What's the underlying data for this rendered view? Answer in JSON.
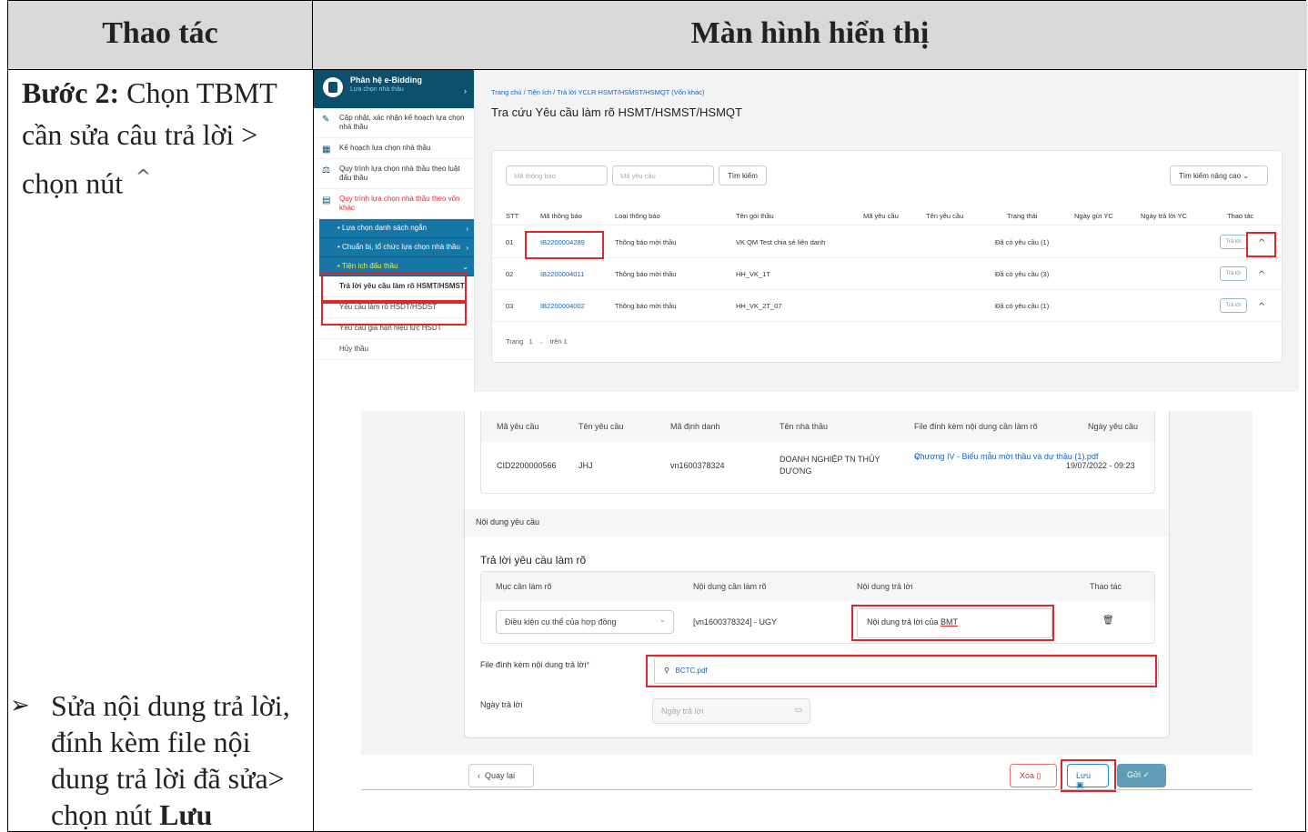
{
  "header": {
    "left": "Thao tác",
    "right": "Màn hình hiển thị"
  },
  "step1": {
    "label": "Bước 2:",
    "text": "Chọn TBMT cần sửa câu trả lời > chọn nút",
    "caret_icon": "chevron-up-icon"
  },
  "step2": {
    "text_a": "Sửa nội dung trả lời, đính kèm file nội dung trả lời đã sửa> chọn nút ",
    "text_b": "Lưu"
  },
  "shot1": {
    "sidebar": {
      "app": "Phân hệ e-Bidding",
      "sub": "Lựa chọn nhà thầu",
      "items": [
        "Cập nhật, xác nhận kế hoạch lựa chọn nhà thầu",
        "Kế hoạch lựa chọn nhà thầu",
        "Quy trình lựa chọn nhà thầu theo luật đấu thầu",
        "Quy trình lựa chọn nhà thầu theo vốn khác"
      ],
      "subs": [
        "Lựa chọn danh sách ngắn",
        "Chuẩn bị, tổ chức lựa chọn nhà thầu",
        "Tiện ích đấu thầu"
      ],
      "leaves": [
        "Trả lời yêu cầu làm rõ HSMT/HSMST",
        "Yêu cầu làm rõ HSDT/HSDST",
        "Yêu cầu gia hạn hiệu lực HSDT",
        "Hủy thầu"
      ]
    },
    "breadcrumb": {
      "home": "Trang chủ",
      "sep": "/",
      "mid": "Tiện ích",
      "last": "Trả lời YCLR HSMT/HSMST/HSMQT (Vốn khác)"
    },
    "title": "Tra cứu Yêu cầu làm rõ HSMT/HSMST/HSMQT",
    "search": {
      "ph1": "Mã thông báo",
      "ph2": "Mã yêu cầu",
      "btn": "Tìm kiếm",
      "adv": "Tìm kiếm nâng cao"
    },
    "columns": [
      "STT",
      "Mã thông báo",
      "Loại thông báo",
      "Tên gói thầu",
      "Mã yêu cầu",
      "Tên yêu cầu",
      "Trạng thái",
      "Ngày gửi YC",
      "Ngày trả lời YC",
      "Thao tác"
    ],
    "rows": [
      {
        "stt": "01",
        "ma": "IB2200004289",
        "loai": "Thông báo mời thầu",
        "ten": "VK QM Test chia sẻ liên danh",
        "tt": "Đã có yêu cầu (1)"
      },
      {
        "stt": "02",
        "ma": "IB2200004011",
        "loai": "Thông báo mời thầu",
        "ten": "HH_VK_1T",
        "tt": "Đã có yêu cầu (3)"
      },
      {
        "stt": "03",
        "ma": "IB2200004002",
        "loai": "Thông báo mời thầu",
        "ten": "HH_VK_2T_07",
        "tt": "Đã có yêu cầu (1)"
      }
    ],
    "reply_btn": "Trả lời",
    "pager": {
      "label": "Trang",
      "page": "1",
      "of": "trên 1"
    }
  },
  "shot2": {
    "cols": [
      "Mã yêu cầu",
      "Tên yêu cầu",
      "Mã định danh",
      "Tên nhà thầu",
      "File đính kèm nội dung cần làm rõ",
      "Ngày yêu cầu"
    ],
    "row": {
      "ma": "CID2200000566",
      "ten": "JHJ",
      "dinh_danh": "vn1600378324",
      "nha_thau": "DOANH NGHIỆP TN THỦY DƯƠNG",
      "file": "Chương IV - Biểu mẫu mời thầu và dự thầu (1).pdf",
      "ngay": "19/07/2022 - 09:23"
    },
    "noi_dung_label": "Nội dung yêu cầu",
    "reply_title": "Trả lời yêu cầu làm rõ",
    "reply_cols": [
      "Mục cần làm rõ",
      "Nội dung cần làm rõ",
      "Nội dung trả lời",
      "Thao tác"
    ],
    "select_value": "Điều kiện cụ thể của hợp đồng",
    "noi_dung_can": "[vn1600378324] - UGY",
    "reply_text_a": "Nội dung trả lời của ",
    "reply_text_b": "BMT",
    "file_label": "File đính kèm nội dung trả lời",
    "required_mark": "*",
    "file_name": "BCTC.pdf",
    "date_label": "Ngày trả lời",
    "date_placeholder": "Ngày trả lời",
    "buttons": {
      "back": "Quay lại",
      "delete": "Xóa",
      "save": "Lưu",
      "send": "Gửi"
    }
  },
  "colors": {
    "highlight": "#e0262a",
    "sidebar": "#0b4f6c",
    "link": "#1565c0"
  }
}
